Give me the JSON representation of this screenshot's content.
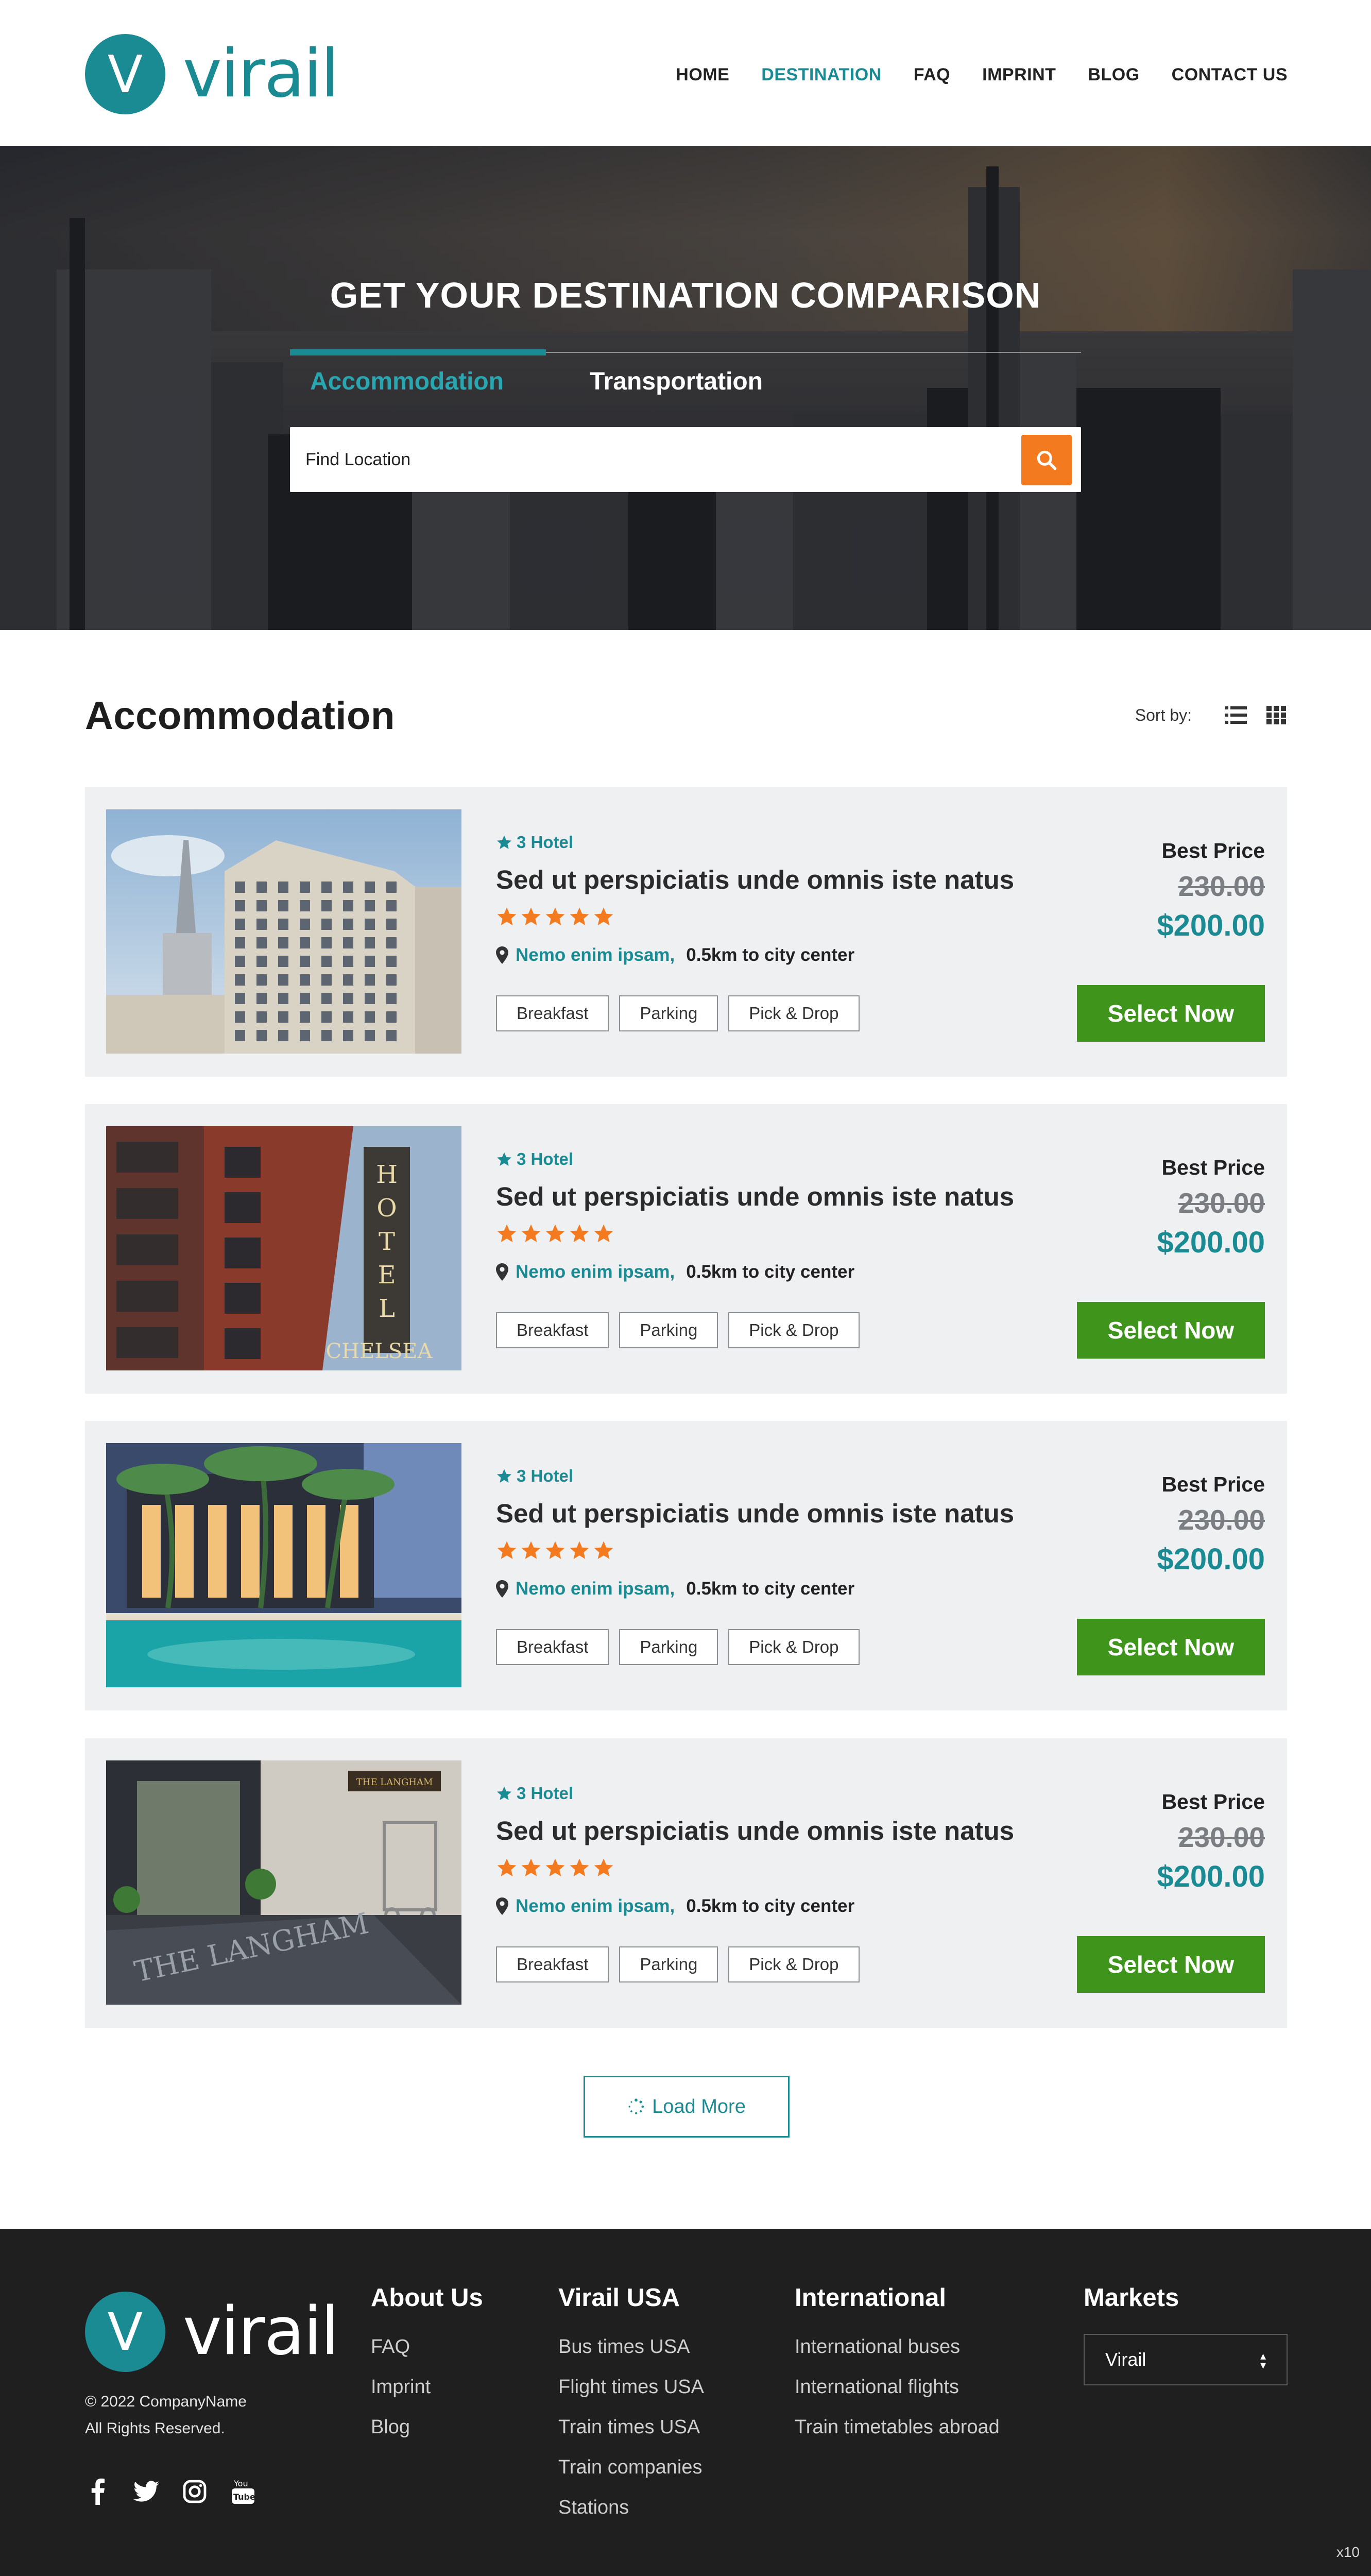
{
  "brand": {
    "name": "virail",
    "mark": "V",
    "color": "#1a8a93"
  },
  "nav": {
    "items": [
      "HOME",
      "DESTINATION",
      "FAQ",
      "IMPRINT",
      "BLOG",
      "CONTACT US"
    ],
    "active": "DESTINATION"
  },
  "hero": {
    "title": "GET YOUR DESTINATION COMPARISON",
    "tabs": [
      "Accommodation",
      "Transportation"
    ],
    "active_tab": "Accommodation",
    "search_placeholder": "Find Location",
    "search_button_icon": "search-icon",
    "search_button_color": "#f47a1f"
  },
  "main": {
    "title": "Accommodation",
    "sort_label": "Sort by:",
    "view_icons": [
      "list-view-icon",
      "grid-view-icon"
    ]
  },
  "hotels": [
    {
      "category": "3 Hotel",
      "name": "Sed ut perspiciatis unde omnis iste natus",
      "rating": 5,
      "city": "Nemo enim ipsam,",
      "distance": "0.5km to city center",
      "amenities": [
        "Breakfast",
        "Parking",
        "Pick & Drop"
      ],
      "best_label": "Best Price",
      "old_price": "230.00",
      "price": "$200.00",
      "button": "Select Now"
    },
    {
      "category": "3 Hotel",
      "name": "Sed ut perspiciatis unde omnis iste natus",
      "rating": 5,
      "city": "Nemo enim ipsam,",
      "distance": "0.5km to city center",
      "amenities": [
        "Breakfast",
        "Parking",
        "Pick & Drop"
      ],
      "best_label": "Best Price",
      "old_price": "230.00",
      "price": "$200.00",
      "button": "Select Now"
    },
    {
      "category": "3 Hotel",
      "name": "Sed ut perspiciatis unde omnis iste natus",
      "rating": 5,
      "city": "Nemo enim ipsam,",
      "distance": "0.5km to city center",
      "amenities": [
        "Breakfast",
        "Parking",
        "Pick & Drop"
      ],
      "best_label": "Best Price",
      "old_price": "230.00",
      "price": "$200.00",
      "button": "Select Now"
    },
    {
      "category": "3 Hotel",
      "name": "Sed ut perspiciatis unde omnis iste natus",
      "rating": 5,
      "city": "Nemo enim ipsam,",
      "distance": "0.5km to city center",
      "amenities": [
        "Breakfast",
        "Parking",
        "Pick & Drop"
      ],
      "best_label": "Best Price",
      "old_price": "230.00",
      "price": "$200.00",
      "button": "Select Now"
    }
  ],
  "hotel_images": [
    "hotel-tower-photo",
    "hotel-chelsea-photo",
    "hotel-pool-photo",
    "hotel-langham-photo"
  ],
  "load_more": "Load More",
  "footer": {
    "brand": "virail",
    "copyright": "© 2022 CompanyName",
    "rights": "All Rights Reserved.",
    "social_icons": [
      "facebook-icon",
      "twitter-icon",
      "instagram-icon",
      "youtube-icon"
    ],
    "columns": [
      {
        "title": "About Us",
        "links": [
          "FAQ",
          "Imprint",
          "Blog"
        ]
      },
      {
        "title": "Virail USA",
        "links": [
          "Bus times USA",
          "Flight times USA",
          "Train times USA",
          "Train companies",
          "Stations"
        ]
      },
      {
        "title": "International",
        "links": [
          "International buses",
          "International flights",
          "Train timetables abroad"
        ]
      }
    ],
    "markets": {
      "title": "Markets",
      "selected": "Virail"
    },
    "zoom": "x10"
  },
  "colors": {
    "accent": "#1a8a93",
    "select_button": "#3f941c",
    "star": "#f47a1f",
    "card_bg": "#eef0f2",
    "footer_bg": "#1f1f1f"
  }
}
